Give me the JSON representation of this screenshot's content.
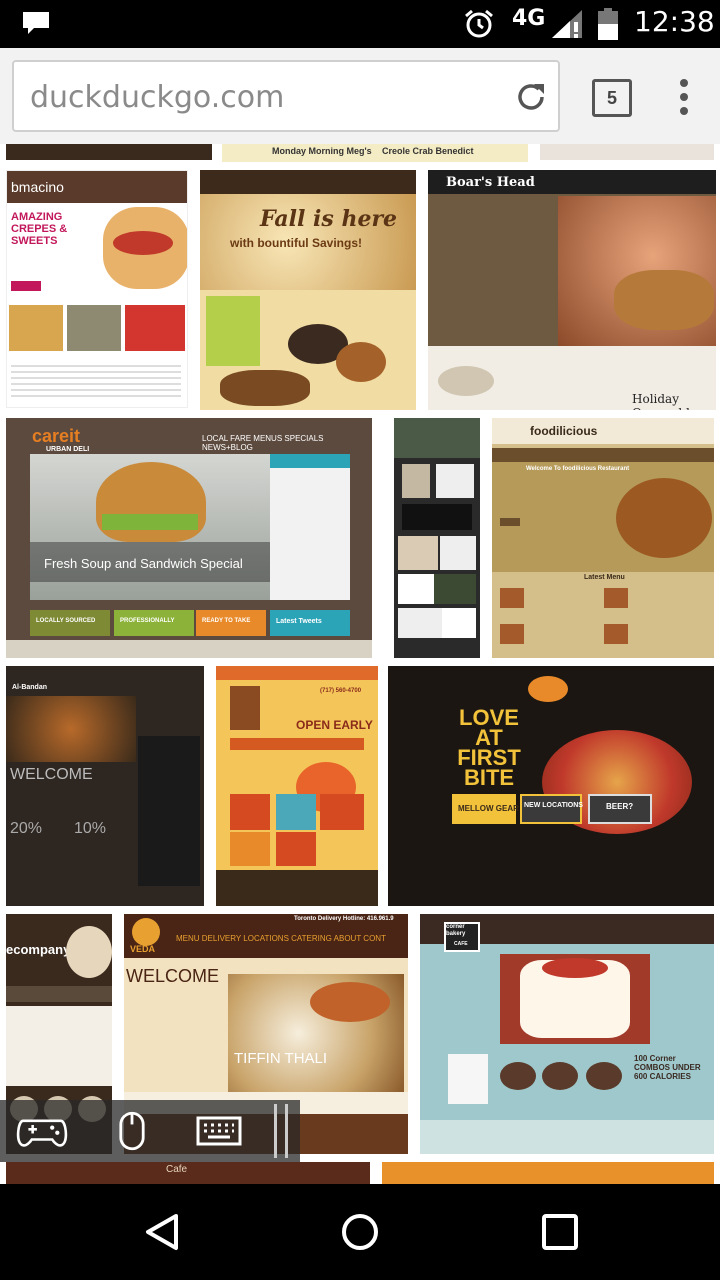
{
  "status_bar": {
    "network": "4G",
    "time": "12:38"
  },
  "browser": {
    "url": "duckduckgo.com",
    "tab_count": "5"
  },
  "results": [
    {
      "name": "strip-1a",
      "text": ""
    },
    {
      "name": "strip-1b",
      "text": "Monday Morning Meg's"
    },
    {
      "name": "strip-1c",
      "text": "Creole Crab Benedict"
    },
    {
      "name": "crepes",
      "text": "AMAZING CREPES & SWEETS",
      "brand": "bmacino"
    },
    {
      "name": "coffee",
      "text": "Fall is here",
      "sub": "with bountiful Savings!"
    },
    {
      "name": "boars-head",
      "text": "Boar's Head",
      "sub": "Holiday Ovengold Turkey Wreath"
    },
    {
      "name": "careit",
      "brand": "careit",
      "tag": "URBAN DELI",
      "text": "Fresh Soup and Sandwich Special",
      "nav": "LOCAL FARE  MENUS  SPECIALS  NEWS+BLOG",
      "badge1": "LOCALLY SOURCED",
      "badge2": "PROFESSIONALLY",
      "badge3": "READY TO TAKE",
      "badge4": "Latest Tweets"
    },
    {
      "name": "recipe-column",
      "text": ""
    },
    {
      "name": "foodilicious",
      "brand": "foodilicious",
      "text": "Welcome To foodilicious Restaurant",
      "sub": "Latest Menu"
    },
    {
      "name": "al-bandan",
      "text": "WELCOME",
      "brand": "Al-Bandan",
      "p1": "20%",
      "p2": "10%"
    },
    {
      "name": "open-early",
      "text": "OPEN EARLY",
      "sub": "(717) 560-4700"
    },
    {
      "name": "pizza",
      "text": "LOVE AT FIRST BITE",
      "b1": "MELLOW GEAR",
      "b2": "NEW LOCATIONS",
      "b3": "BEER?"
    },
    {
      "name": "coffee-company",
      "text": "ecompany"
    },
    {
      "name": "veda",
      "brand": "VEDA",
      "text": "WELCOME",
      "sub": "TIFFIN THALI",
      "nav": "MENU  DELIVERY  LOCATIONS  CATERING  ABOUT  CONT",
      "phone": "Toronto Delivery Hotline: 416.961.9"
    },
    {
      "name": "corner-bakery",
      "brand": "corner bakery",
      "tag": "CAFE",
      "text": "100 Corner COMBOS UNDER 600 CALORIES"
    },
    {
      "name": "bottom-1",
      "text": "Cafe"
    },
    {
      "name": "bottom-2",
      "text": ""
    }
  ]
}
